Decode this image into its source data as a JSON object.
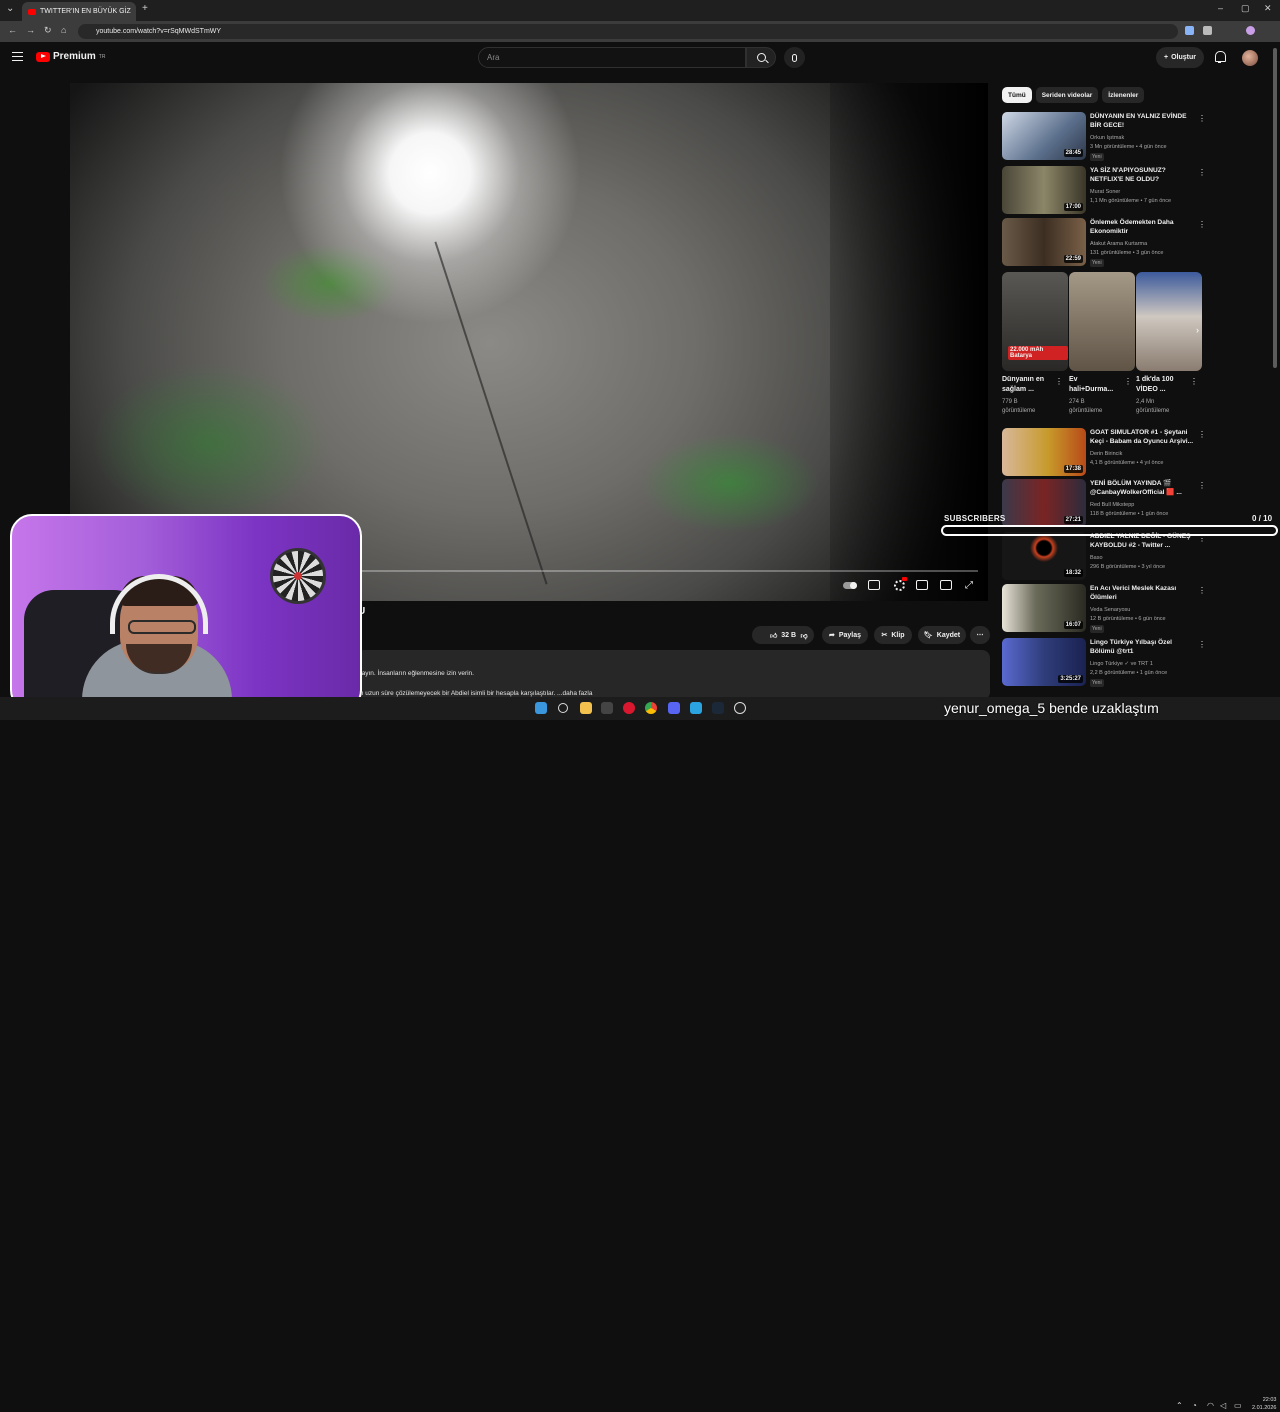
{
  "browser": {
    "tab_title": "TWITTER'IN EN BÜYÜK GİZ",
    "url": "youtube.com/watch?v=rSqMWdSTmWY"
  },
  "youtube": {
    "logo_text": "Premium",
    "logo_region": "TR",
    "search_placeholder": "Ara",
    "create_label": "Oluştur"
  },
  "video": {
    "title_fragment": "U",
    "likes": "32 B",
    "share_label": "Paylaş",
    "clip_label": "Klip",
    "save_label": "Kaydet",
    "desc_line1": "nayın. İnsanların eğlenmesine izin verin.",
    "desc_line2": "m uzun süre çözülemeyecek bir Abdiel isimli bir hesapla karşılaştılar. ...daha fazla"
  },
  "chips": [
    "Tümü",
    "Seriden videolar",
    "İzlenenler"
  ],
  "recommendations_top": [
    {
      "title": "DÜNYANIN EN YALNIZ EVİNDE BİR GECE!",
      "channel": "Orkun Işıtmak",
      "meta": "3 Mn görüntüleme • 4 gün önce",
      "badge": "Yeni",
      "duration": "28:45",
      "thumb_color": "#5b6f8c"
    },
    {
      "title": "YA SİZ N'APIYOSUNUZ? NETFLIX'E NE OLDU?",
      "channel": "Murat Soner",
      "meta": "1,1 Mn görüntüleme • 7 gün önce",
      "badge": "",
      "duration": "17:00",
      "thumb_color": "#6e6a52"
    },
    {
      "title": "Önlemek Ödemekten Daha Ekonomiktir",
      "channel": "Atakut Arama Kurtarma",
      "meta": "131 görüntüleme • 3 gün önce",
      "badge": "Yeni",
      "duration": "22:59",
      "thumb_color": "#5a4b3c"
    }
  ],
  "shorts": [
    {
      "title": "Dünyanın en sağlam ...",
      "views": "779 B görüntüleme",
      "thumb_color": "#3d3b38",
      "caption": "22.000 mAh Batarya"
    },
    {
      "title": "Ev hali+Durma...",
      "views": "274 B görüntüleme",
      "thumb_color": "#7f7465",
      "caption": ""
    },
    {
      "title": "1 dk'da 100 VİDEO ...",
      "views": "2,4 Mn görüntüleme",
      "thumb_color": "#b5b0aa",
      "caption": ""
    }
  ],
  "recommendations_bottom": [
    {
      "title": "GOAT SIMULATOR #1 - Şeytani Keçi - Babam da Oyuncu Arşivi...",
      "channel": "Derin Birincik",
      "meta": "4,1 B görüntüleme • 4 yıl önce",
      "badge": "",
      "duration": "17:38",
      "thumb_color": "#c79a2b"
    },
    {
      "title": "YENİ BÖLÜM YAYINDA 🎬 @CanbayWolkerOfficial 🟥 ...",
      "channel": "Red Bull Mikstepp",
      "meta": "118 B görüntüleme • 1 gün önce",
      "badge": "",
      "duration": "27:21",
      "thumb_color": "#7a2424"
    },
    {
      "title": "ABDIEL YALNIZ DEĞİL - GÜNEŞ KAYBOLDU #2 - Twitter ...",
      "channel": "Baso",
      "meta": "296 B görüntüleme • 3 yıl önce",
      "badge": "",
      "duration": "18:32",
      "thumb_color": "#161616"
    },
    {
      "title": "En Acı Verici Meslek Kazası Ölümleri",
      "channel": "Veda Senaryosu",
      "meta": "12 B görüntüleme • 6 gün önce",
      "badge": "Yeni",
      "duration": "16:07",
      "thumb_color": "#6b6b5a"
    },
    {
      "title": "Lingo Türkiye Yılbaşı Özel Bölümü @trt1",
      "channel": "Lingo Türkiye ✓ ve TRT 1",
      "meta": "2,2 B görüntüleme • 1 gün önce",
      "badge": "Yeni",
      "duration": "3:25:27",
      "thumb_color": "#2f3d7a"
    }
  ],
  "overlay": {
    "subscribers_label": "SUBSCRIBERS",
    "subscribers_count": "0 / 10",
    "subscribers_progress": 0,
    "chat_user": "yenur_omega_5",
    "chat_message": "bende uzaklaştım"
  },
  "taskbar": {
    "time": "22:03",
    "date": "2.01.2026"
  }
}
